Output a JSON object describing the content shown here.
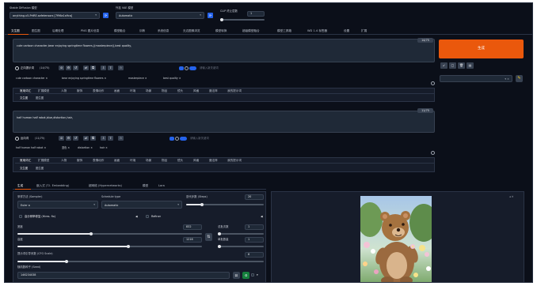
{
  "header": {
    "checkpoint_label": "Stable Diffusion 模型",
    "checkpoint_value": "anything-v5-PrtRE.safetensors [7f96a1a9ca]",
    "vae_label": "外挂 VAE 模型",
    "vae_value": "Automatic",
    "clip_label": "CLIP 终止层数",
    "clip_value": "1"
  },
  "tabs": [
    "文生图",
    "图生图",
    "后期处理",
    "PNG 图片信息",
    "模型融合",
    "训练",
    "系统信息",
    "无边图像浏览",
    "模型转换",
    "超级模型融合",
    "模型工具箱",
    "WD 1.4 标签器",
    "设置",
    "扩展"
  ],
  "positive": {
    "text": "cute cartoon character,bear enjoying springtime flowers,((masterpiece)),best quality,",
    "token_count": "14/75",
    "label": "正向提示词",
    "label_count": "(14/75)",
    "keyword_placeholder": "请输入新关键词",
    "chips": [
      "cute cartoon character",
      "bear enjoying springtime flowers",
      "masterpiece",
      "best quality"
    ]
  },
  "negative": {
    "text": "half human half robot,blue,distortion,hair,",
    "token_count": "11/75",
    "label": "反向词",
    "label_count": "(11/75)",
    "keyword_placeholder": "请输入新关键词",
    "chips": [
      "half human half robot",
      "蓝色",
      "distortion",
      "hair"
    ]
  },
  "category_tabs": [
    "常用词汇",
    "扩展模型",
    "人物",
    "服饰",
    "表情动作",
    "画面",
    "环境",
    "场景",
    "物品",
    "镜头",
    "风格",
    "魔法阵",
    "我的提示词"
  ],
  "sub_tabs": [
    "文生图",
    "图生图"
  ],
  "generate_label": "生成",
  "toolbar_icons": [
    "↙",
    "▢",
    "🗑",
    "▤"
  ],
  "styles_caret": "▾ ×",
  "lower_tabs": [
    "生成",
    "嵌入式 (T.I. Embedding)",
    "超网络 (Hypernetworks)",
    "模型",
    "Lora"
  ],
  "params": {
    "sampler_label": "采样方法 (Sampler)",
    "sampler_value": "Euler a",
    "schedule_label": "Schedule type",
    "schedule_value": "Automatic",
    "steps_label": "迭代步数 (Steps)",
    "steps_value": "20",
    "steps_level": 0.2,
    "hires_label": "高分辨率修复 (Hires. fix)",
    "refiner_label": "Refiner",
    "width_label": "宽度",
    "width_value": "832",
    "width_level": 0.4,
    "height_label": "高度",
    "height_value": "1216",
    "height_level": 0.6,
    "batch_count_label": "总批次数",
    "batch_count_value": "1",
    "batch_size_label": "单批数量",
    "batch_size_value": "1",
    "cfg_label": "提示词引导系数 (CFG Scale)",
    "cfg_value": "6",
    "cfg_level": 0.2,
    "seed_label": "随机数种子 (Seed)",
    "seed_value": "146234038"
  },
  "colors": {
    "generate": "#ea580c",
    "bg": "#0b0f19",
    "panel": "#161c2a",
    "accent": "#2563eb"
  }
}
